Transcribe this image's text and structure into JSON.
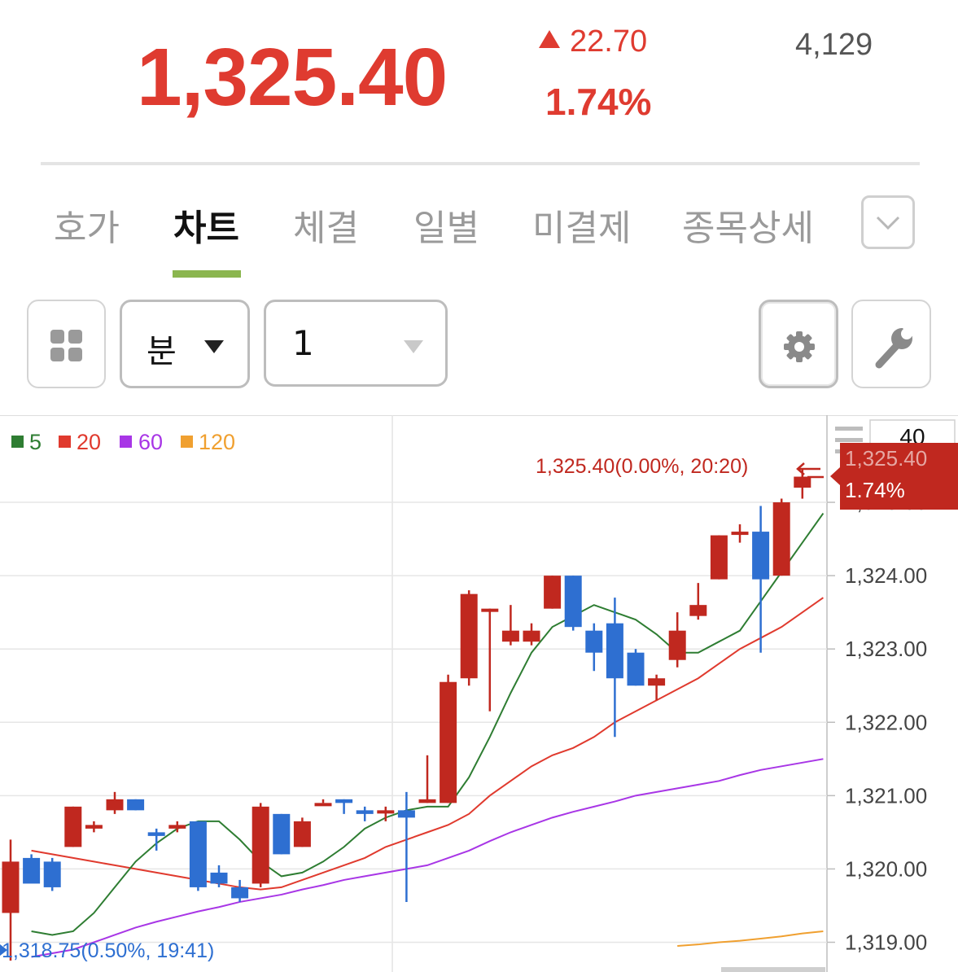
{
  "quote": {
    "price": "1,325.40",
    "change": "22.70",
    "change_pct": "1.74%",
    "volume": "4,129"
  },
  "tabs": [
    {
      "label": "호가",
      "active": false
    },
    {
      "label": "차트",
      "active": true
    },
    {
      "label": "체결",
      "active": false
    },
    {
      "label": "일별",
      "active": false
    },
    {
      "label": "미결제",
      "active": false
    },
    {
      "label": "종목상세",
      "active": false
    }
  ],
  "toolbar": {
    "period_unit": "분",
    "period_value": "1",
    "zoom_value": "40"
  },
  "colors": {
    "up": "#c0281f",
    "down": "#2e6fd1",
    "ma5": "#2e7d32",
    "ma20": "#e03a2e",
    "ma60": "#a836e6",
    "ma120": "#f0a030",
    "accent_tab": "#8bb64f"
  },
  "icons": [
    "grid-icon",
    "dropdown-arrow-icon",
    "gear-icon",
    "wrench-icon",
    "chevron-down-icon",
    "menu-icon",
    "arrow-left-icon"
  ],
  "chart_data": {
    "type": "candlestick",
    "legend": [
      {
        "label": "5",
        "color": "#2e7d32"
      },
      {
        "label": "20",
        "color": "#e03a2e"
      },
      {
        "label": "60",
        "color": "#a836e6"
      },
      {
        "label": "120",
        "color": "#f0a030"
      }
    ],
    "y_ticks": [
      "1,325.00",
      "1,324.00",
      "1,323.00",
      "1,322.00",
      "1,321.00",
      "1,320.00",
      "1,319.00"
    ],
    "ylim": [
      1318.75,
      1325.8
    ],
    "last_price_label": "1,325.40",
    "last_pct_label": "1.74%",
    "high_annotation": "1,325.40(0.00%, 20:20)",
    "low_annotation": "1,318.75(0.50%, 19:41)",
    "candles": [
      {
        "o": 1319.4,
        "h": 1320.4,
        "l": 1318.75,
        "c": 1320.1
      },
      {
        "o": 1320.15,
        "h": 1320.2,
        "l": 1319.85,
        "c": 1319.8
      },
      {
        "o": 1320.1,
        "h": 1320.15,
        "l": 1319.7,
        "c": 1319.75
      },
      {
        "o": 1320.3,
        "h": 1320.85,
        "l": 1320.3,
        "c": 1320.85
      },
      {
        "o": 1320.55,
        "h": 1320.65,
        "l": 1320.5,
        "c": 1320.6
      },
      {
        "o": 1320.8,
        "h": 1321.05,
        "l": 1320.75,
        "c": 1320.95
      },
      {
        "o": 1320.95,
        "h": 1320.95,
        "l": 1320.8,
        "c": 1320.8
      },
      {
        "o": 1320.5,
        "h": 1320.55,
        "l": 1320.25,
        "c": 1320.45
      },
      {
        "o": 1320.55,
        "h": 1320.65,
        "l": 1320.5,
        "c": 1320.6
      },
      {
        "o": 1320.65,
        "h": 1320.65,
        "l": 1319.7,
        "c": 1319.75
      },
      {
        "o": 1319.95,
        "h": 1320.05,
        "l": 1319.75,
        "c": 1319.8
      },
      {
        "o": 1319.75,
        "h": 1319.85,
        "l": 1319.55,
        "c": 1319.6
      },
      {
        "o": 1319.8,
        "h": 1320.9,
        "l": 1319.75,
        "c": 1320.85
      },
      {
        "o": 1320.75,
        "h": 1320.75,
        "l": 1320.2,
        "c": 1320.2
      },
      {
        "o": 1320.3,
        "h": 1320.7,
        "l": 1320.3,
        "c": 1320.65
      },
      {
        "o": 1320.9,
        "h": 1320.95,
        "l": 1320.9,
        "c": 1320.9
      },
      {
        "o": 1320.95,
        "h": 1320.95,
        "l": 1320.75,
        "c": 1320.9
      },
      {
        "o": 1320.8,
        "h": 1320.85,
        "l": 1320.65,
        "c": 1320.75
      },
      {
        "o": 1320.8,
        "h": 1320.85,
        "l": 1320.65,
        "c": 1320.8
      },
      {
        "o": 1320.8,
        "h": 1321.05,
        "l": 1319.55,
        "c": 1320.7
      },
      {
        "o": 1320.9,
        "h": 1321.55,
        "l": 1320.9,
        "c": 1320.95
      },
      {
        "o": 1320.9,
        "h": 1322.65,
        "l": 1320.9,
        "c": 1322.55
      },
      {
        "o": 1322.6,
        "h": 1323.8,
        "l": 1322.5,
        "c": 1323.75
      },
      {
        "o": 1323.55,
        "h": 1323.55,
        "l": 1322.15,
        "c": 1323.55
      },
      {
        "o": 1323.1,
        "h": 1323.6,
        "l": 1323.05,
        "c": 1323.25
      },
      {
        "o": 1323.1,
        "h": 1323.35,
        "l": 1323.05,
        "c": 1323.25
      },
      {
        "o": 1323.55,
        "h": 1324.0,
        "l": 1323.55,
        "c": 1324.0
      },
      {
        "o": 1324.0,
        "h": 1324.0,
        "l": 1323.25,
        "c": 1323.3
      },
      {
        "o": 1323.25,
        "h": 1323.35,
        "l": 1322.7,
        "c": 1322.95
      },
      {
        "o": 1323.35,
        "h": 1323.7,
        "l": 1321.8,
        "c": 1322.6
      },
      {
        "o": 1322.95,
        "h": 1323.0,
        "l": 1322.5,
        "c": 1322.5
      },
      {
        "o": 1322.5,
        "h": 1322.65,
        "l": 1322.3,
        "c": 1322.6
      },
      {
        "o": 1322.85,
        "h": 1323.5,
        "l": 1322.75,
        "c": 1323.25
      },
      {
        "o": 1323.45,
        "h": 1323.9,
        "l": 1323.4,
        "c": 1323.6
      },
      {
        "o": 1323.95,
        "h": 1324.55,
        "l": 1323.95,
        "c": 1324.55
      },
      {
        "o": 1324.6,
        "h": 1324.7,
        "l": 1324.45,
        "c": 1324.6
      },
      {
        "o": 1324.6,
        "h": 1324.95,
        "l": 1322.95,
        "c": 1323.95
      },
      {
        "o": 1324.0,
        "h": 1325.05,
        "l": 1324.0,
        "c": 1325.0
      },
      {
        "o": 1325.2,
        "h": 1325.45,
        "l": 1325.05,
        "c": 1325.35
      }
    ],
    "ma5": [
      1319.15,
      1319.1,
      1319.15,
      1319.4,
      1319.75,
      1320.1,
      1320.35,
      1320.55,
      1320.65,
      1320.65,
      1320.4,
      1320.1,
      1319.9,
      1319.95,
      1320.1,
      1320.3,
      1320.55,
      1320.7,
      1320.8,
      1320.85,
      1320.85,
      1321.25,
      1321.8,
      1322.4,
      1322.95,
      1323.3,
      1323.45,
      1323.6,
      1323.5,
      1323.4,
      1323.2,
      1322.95,
      1322.95,
      1323.1,
      1323.25,
      1323.65,
      1324.05,
      1324.45,
      1324.85
    ],
    "ma20": [
      1320.25,
      1320.2,
      1320.15,
      1320.1,
      1320.05,
      1320.0,
      1319.95,
      1319.9,
      1319.85,
      1319.8,
      1319.75,
      1319.72,
      1319.75,
      1319.85,
      1319.95,
      1320.05,
      1320.15,
      1320.3,
      1320.4,
      1320.5,
      1320.6,
      1320.75,
      1321.0,
      1321.2,
      1321.4,
      1321.55,
      1321.65,
      1321.8,
      1322.0,
      1322.15,
      1322.3,
      1322.45,
      1322.6,
      1322.8,
      1323.0,
      1323.15,
      1323.3,
      1323.5,
      1323.7
    ],
    "ma60": [
      1318.8,
      1318.85,
      1318.9,
      1319.0,
      1319.1,
      1319.2,
      1319.28,
      1319.35,
      1319.42,
      1319.48,
      1319.55,
      1319.6,
      1319.65,
      1319.72,
      1319.78,
      1319.85,
      1319.9,
      1319.95,
      1320.0,
      1320.05,
      1320.15,
      1320.25,
      1320.38,
      1320.5,
      1320.6,
      1320.7,
      1320.78,
      1320.85,
      1320.92,
      1321.0,
      1321.05,
      1321.1,
      1321.15,
      1321.2,
      1321.28,
      1321.35,
      1321.4,
      1321.45,
      1321.5
    ],
    "ma120_start_index": 31,
    "ma120": [
      1318.95,
      1318.97,
      1319.0,
      1319.02,
      1319.05,
      1319.08,
      1319.12,
      1319.15
    ]
  }
}
